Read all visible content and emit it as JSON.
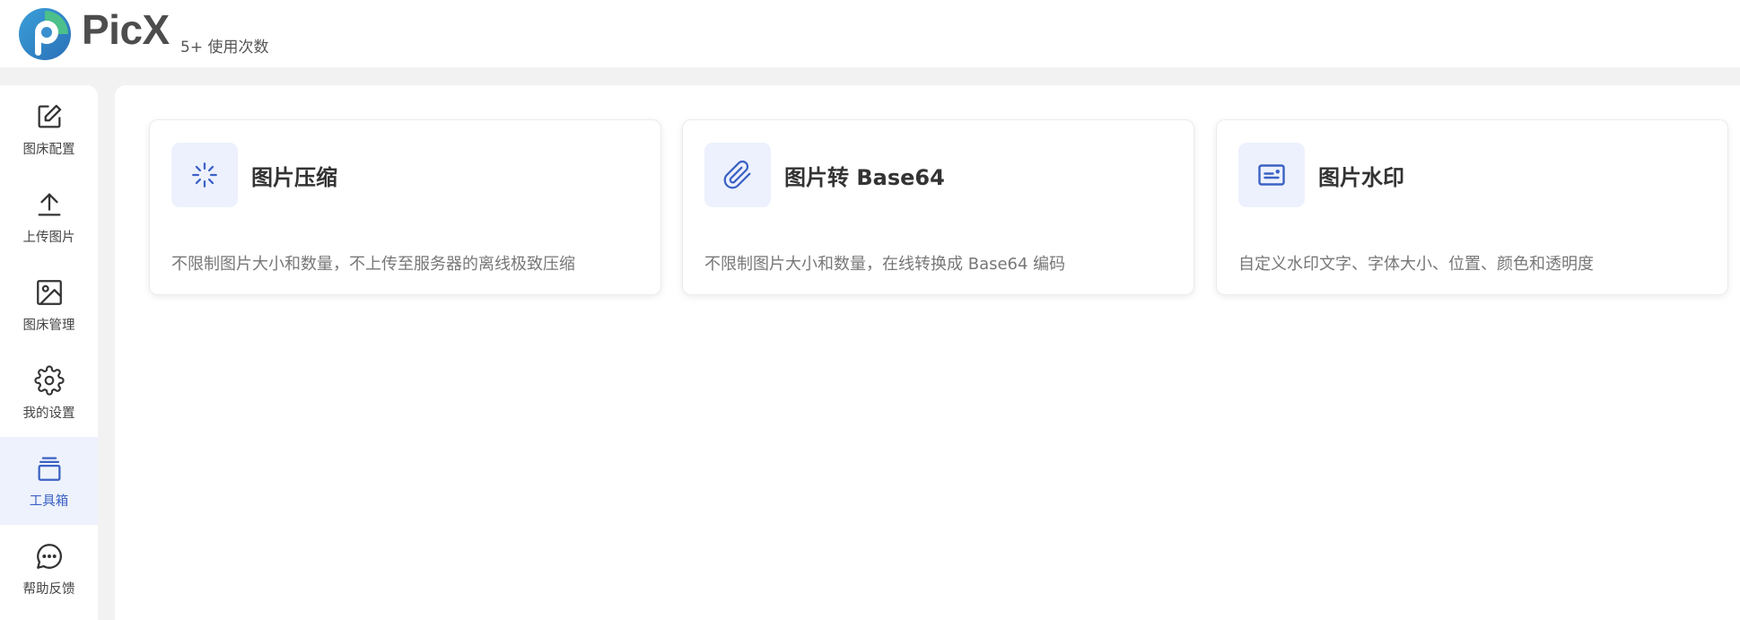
{
  "header": {
    "brand": "PicX",
    "usage": "5+ 使用次数"
  },
  "sidebar": {
    "items": [
      {
        "label": "图床配置",
        "icon": "edit-icon"
      },
      {
        "label": "上传图片",
        "icon": "upload-icon"
      },
      {
        "label": "图床管理",
        "icon": "image-icon"
      },
      {
        "label": "我的设置",
        "icon": "gear-icon"
      },
      {
        "label": "工具箱",
        "icon": "toolbox-icon",
        "active": true
      },
      {
        "label": "帮助反馈",
        "icon": "chat-icon"
      }
    ]
  },
  "tools": [
    {
      "title": "图片压缩",
      "desc": "不限制图片大小和数量，不上传至服务器的离线极致压缩",
      "icon": "compress-icon"
    },
    {
      "title": "图片转 Base64",
      "desc": "不限制图片大小和数量，在线转换成 Base64 编码",
      "icon": "paperclip-icon"
    },
    {
      "title": "图片水印",
      "desc": "自定义水印文字、字体大小、位置、颜色和透明度",
      "icon": "watermark-icon"
    }
  ],
  "colors": {
    "accent": "#3b62c4",
    "icon_bg": "#edf1fd",
    "active_bg": "#eef2fc"
  }
}
